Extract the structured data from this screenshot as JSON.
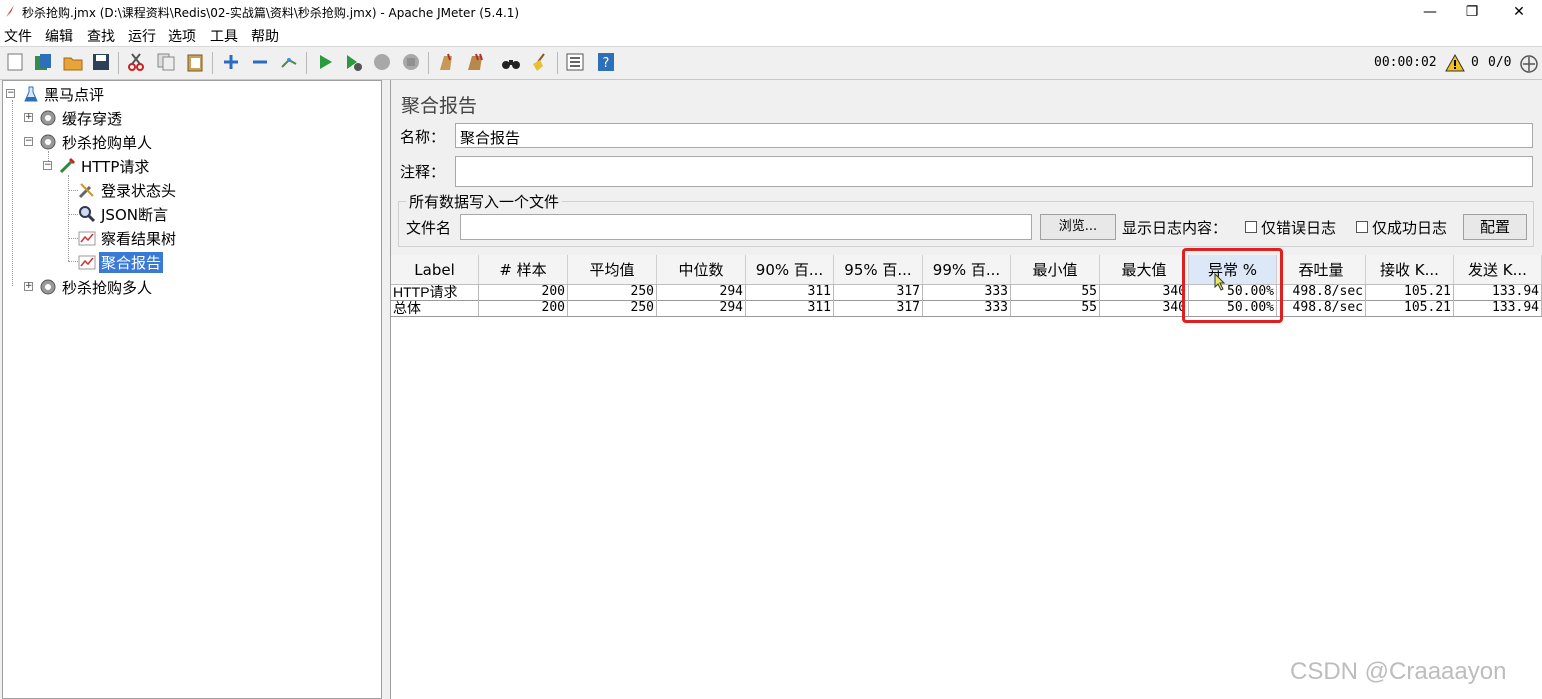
{
  "window": {
    "title": "秒杀抢购.jmx (D:\\课程资料\\Redis\\02-实战篇\\资料\\秒杀抢购.jmx) - Apache JMeter (5.4.1)",
    "controls": [
      "—",
      "❐",
      "✕"
    ]
  },
  "menu": [
    "文件",
    "编辑",
    "查找",
    "运行",
    "选项",
    "工具",
    "帮助"
  ],
  "status": {
    "timer": "00:00:02",
    "warning_count": "0",
    "threads": "0/0"
  },
  "tree": {
    "root": "黑马点评",
    "nodes": [
      {
        "label": "缓存穿透",
        "icon": "thread-group-gear-icon"
      },
      {
        "label": "秒杀抢购单人",
        "icon": "thread-group-gear-icon"
      },
      {
        "label": "HTTP请求",
        "icon": "http-sampler-pipette-icon"
      },
      {
        "label": "登录状态头",
        "icon": "header-manager-wrench-icon"
      },
      {
        "label": "JSON断言",
        "icon": "assertion-magnifier-icon"
      },
      {
        "label": "察看结果树",
        "icon": "listener-chart-icon"
      },
      {
        "label": "聚合报告",
        "icon": "listener-chart-icon"
      },
      {
        "label": "秒杀抢购多人",
        "icon": "thread-group-gear-icon"
      }
    ]
  },
  "panel": {
    "title": "聚合报告",
    "name_label": "名称：",
    "name_value": "聚合报告",
    "comment_label": "注释：",
    "comment_value": "",
    "file_group_title": "所有数据写入一个文件",
    "file_label": "文件名",
    "file_value": "",
    "browse_button": "浏览...",
    "log_content_label": "显示日志内容：",
    "errors_only_label": "仅错误日志",
    "success_only_label": "仅成功日志",
    "config_button": "配置"
  },
  "table": {
    "columns": [
      "Label",
      "# 样本",
      "平均值",
      "中位数",
      "90% 百...",
      "95% 百...",
      "99% 百...",
      "最小值",
      "最大值",
      "异常 %",
      "吞吐量",
      "接收 K...",
      "发送 K..."
    ],
    "sorted_column": "异常 %",
    "rows": [
      [
        "HTTP请求",
        "200",
        "250",
        "294",
        "311",
        "317",
        "333",
        "55",
        "340",
        "50.00%",
        "498.8/sec",
        "105.21",
        "133.94"
      ],
      [
        "总体",
        "200",
        "250",
        "294",
        "311",
        "317",
        "333",
        "55",
        "340",
        "50.00%",
        "498.8/sec",
        "105.21",
        "133.94"
      ]
    ]
  },
  "watermark": "CSDN @Craaaayon",
  "colors": {
    "selection": "#3a79d6",
    "highlight_box": "#e02020"
  }
}
